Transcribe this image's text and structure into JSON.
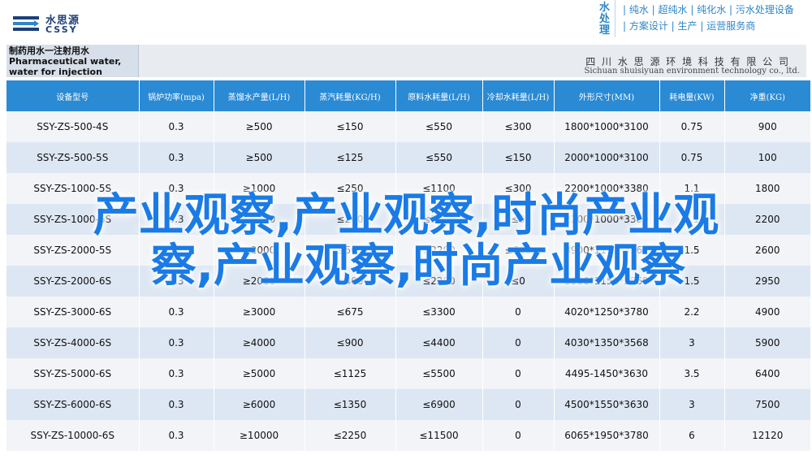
{
  "header": {
    "logo_cn": "水思源",
    "logo_en": "CSSY",
    "brand_vertical": "水处理",
    "brand_line1": "| 纯水 | 超纯水 | 纯化水 | 污水处理设备",
    "brand_line2": "| 方案设计 | 生产 | 运营服务商"
  },
  "document": {
    "title": "制药用水一注射用水 Pharmaceutical water, water for injection",
    "company_cn": "四 川 水 思 源 环 境 科 技 有 限 公 司",
    "company_en": "Sichuan shuisiyuan environment technology co., ltd."
  },
  "table": {
    "headers": [
      "设备型号",
      "锅炉功率(mpa)",
      "蒸馏水产量(L/H)",
      "蒸汽耗量(KG/H)",
      "原料水耗量(L/H)",
      "冷却水耗量(L/H)",
      "外形尺寸(MM)",
      "耗电量(KW)",
      "净重(KG)"
    ],
    "rows": [
      [
        "SSY-ZS-500-4S",
        "0.3",
        "≥500",
        "≤150",
        "≤550",
        "≤300",
        "1800*1000*3100",
        "0.75",
        "900"
      ],
      [
        "SSY-ZS-500-5S",
        "0.3",
        "≥500",
        "≤125",
        "≤550",
        "≤150",
        "2000*1000*3100",
        "0.75",
        "100"
      ],
      [
        "SSY-ZS-1000-5S",
        "0.3",
        "≥1000",
        "≤250",
        "≤1100",
        "≤300",
        "2200*1000*3380",
        "1.1",
        "1800"
      ],
      [
        "SSY-ZS-1000-6S",
        "0.3",
        "≥1000",
        "≤200",
        "≤1100",
        "≤0",
        "2200*1000*3380",
        "1.1",
        "2200"
      ],
      [
        "SSY-ZS-2000-5S",
        "0.3",
        "≥2000",
        "≤500",
        "≤2200",
        "≤600",
        "3900*1150*3560",
        "1.5",
        "2600"
      ],
      [
        "SSY-ZS-2000-6S",
        "0.3",
        "≥2000",
        "≤400",
        "≤2200",
        "≤0",
        "3900*1150*3560",
        "1.5",
        "2950"
      ],
      [
        "SSY-ZS-3000-6S",
        "0.3",
        "≥3000",
        "≤675",
        "≤3300",
        "0",
        "4020*1250*3780",
        "2.2",
        "4900"
      ],
      [
        "SSY-ZS-4000-6S",
        "0.3",
        "≥4000",
        "≤900",
        "≤4400",
        "0",
        "4030*1350*3568",
        "3",
        "5900"
      ],
      [
        "SSY-ZS-5000-6S",
        "0.3",
        "≥5000",
        "≤1125",
        "≤5500",
        "0",
        "4495-1450*3630",
        "3.5",
        "6400"
      ],
      [
        "SSY-ZS-6000-6S",
        "0.3",
        "≥6000",
        "≤1350",
        "≤6900",
        "0",
        "4500*1550*3630",
        "3",
        "7500"
      ],
      [
        "SSY-ZS-10000-6S",
        "0.3",
        "≥10000",
        "≤2250",
        "≤11500",
        "0",
        "6065*1950*3780",
        "6",
        "12120"
      ]
    ]
  },
  "overlay": {
    "line1": "产业观察,产业观察,时尚产业观",
    "line2": "察,产业观察,时尚产业观察"
  },
  "colors": {
    "header_blue": "#2a8ad4",
    "row_light": "#f2f4f7",
    "row_blue": "#dde7f3",
    "overlay_blue": "#1a7be6",
    "brand_blue": "#2e86c8",
    "logo_navy": "#1e3f78"
  }
}
